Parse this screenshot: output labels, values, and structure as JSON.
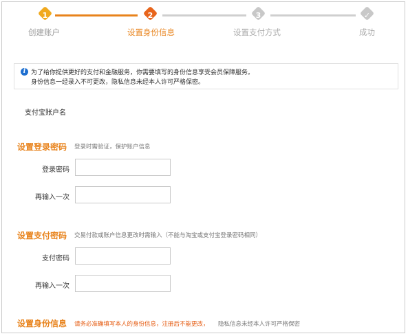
{
  "stepper": {
    "steps": [
      {
        "number": "1",
        "label": "创建账户",
        "state": "done"
      },
      {
        "number": "2",
        "label": "设置身份信息",
        "state": "active"
      },
      {
        "number": "3",
        "label": "设置支付方式",
        "state": "pending"
      },
      {
        "number": "✓",
        "label": "成功",
        "state": "pending"
      }
    ],
    "colors": {
      "active": "#e8831c",
      "done_label": "#999999",
      "active_label": "#e8831c",
      "pending": "#c8c8c8",
      "pending_label": "#aaaaaa"
    }
  },
  "notice": {
    "icon": "info-icon",
    "line1": "为了给你提供更好的支付和金融服务，你需要填写的身份信息享受会员保障服务。",
    "line2": "身份信息一经录入不可更改，隐私信息未经本人许可严格保密。"
  },
  "account": {
    "label": "支付宝账户名"
  },
  "login_section": {
    "title": "设置登录密码",
    "hint": "登录时需验证，保护账户信息",
    "fields": [
      {
        "label": "登录密码",
        "value": ""
      },
      {
        "label": "再输入一次",
        "value": ""
      }
    ]
  },
  "pay_section": {
    "title": "设置支付密码",
    "hint": "交易付款或账户信息更改时需输入（不能与淘宝或支付宝登录密码相同）",
    "fields": [
      {
        "label": "支付密码",
        "value": ""
      },
      {
        "label": "再输入一次",
        "value": ""
      }
    ]
  },
  "identity_section": {
    "title": "设置身份信息",
    "hint_red": "请务必准确填写本人的身份信息，注册后不能更改，",
    "hint_grey": "隐私信息未经本人许可严格保密"
  }
}
